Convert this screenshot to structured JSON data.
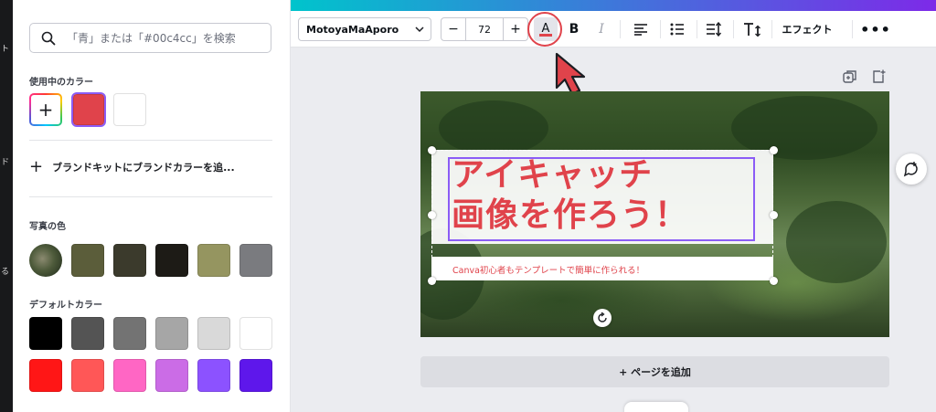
{
  "rail": {
    "glyphs": [
      "ト",
      "ド",
      "る"
    ]
  },
  "panel": {
    "search_placeholder": "「青」または「#00c4cc」を検索",
    "in_use_label": "使用中のカラー",
    "in_use_colors": [
      "#e0434b",
      "#ffffff"
    ],
    "brand_label": "ブランドキットにブランドカラーを追...",
    "photo_label": "写真の色",
    "photo_colors": [
      "#5b5d3a",
      "#3b3a2c",
      "#1d1b16",
      "#959560",
      "#7a7b7f"
    ],
    "default_label": "デフォルトカラー",
    "default_colors_row1": [
      "#000000",
      "#545454",
      "#737373",
      "#a6a6a6",
      "#d9d9d9",
      "#ffffff"
    ],
    "default_colors_row2": [
      "#ff1616",
      "#ff5757",
      "#ff66c4",
      "#cb6ce6",
      "#8c52ff",
      "#5e17eb"
    ]
  },
  "toolbar": {
    "font_name": "MotoyaMaAporo",
    "font_size": "72",
    "minus": "−",
    "plus": "+",
    "text_color_glyph": "A",
    "text_color": "#e0434b",
    "bold_glyph": "B",
    "italic_glyph": "I",
    "effect_label": "エフェクト",
    "more_glyph": "•••"
  },
  "canvas": {
    "title_line1": "アイキャッチ",
    "title_line2": "画像を作ろう！",
    "subtitle": "Canva初心者もテンプレートで簡単に作られる！",
    "add_page_label": "+ ページを追加"
  },
  "colors": {
    "accent": "#8b5cf6",
    "brand_red": "#e0434b"
  }
}
